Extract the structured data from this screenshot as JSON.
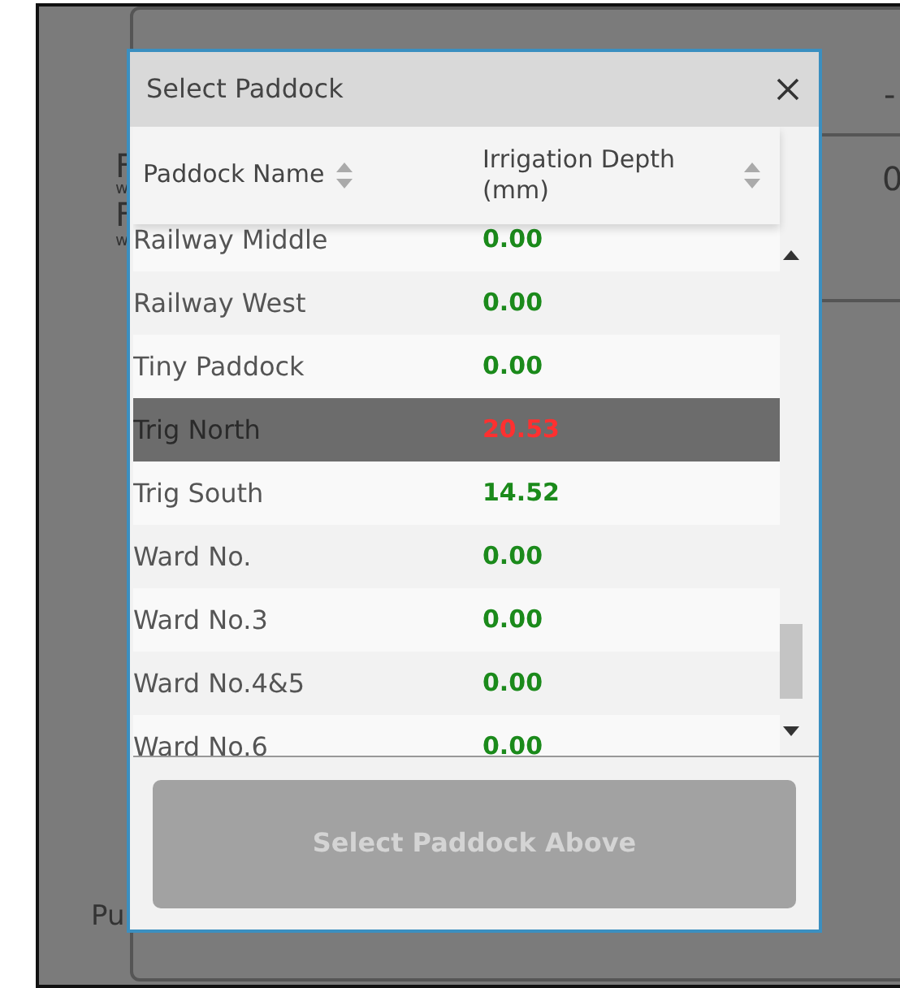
{
  "background_texts": [
    "F",
    "w",
    "F",
    "w",
    "-",
    "0",
    "Pu"
  ],
  "dialog": {
    "title": "Select Paddock",
    "columns": [
      {
        "label": "Paddock Name"
      },
      {
        "label": "Irrigation Depth (mm)"
      }
    ],
    "rows": [
      {
        "name": "Railway Middle",
        "depth": "0.00",
        "selected": false
      },
      {
        "name": "Railway West",
        "depth": "0.00",
        "selected": false
      },
      {
        "name": "Tiny Paddock",
        "depth": "0.00",
        "selected": false
      },
      {
        "name": "Trig North",
        "depth": "20.53",
        "selected": true
      },
      {
        "name": "Trig South",
        "depth": "14.52",
        "selected": false
      },
      {
        "name": "Ward No.",
        "depth": "0.00",
        "selected": false
      },
      {
        "name": "Ward No.3",
        "depth": "0.00",
        "selected": false
      },
      {
        "name": "Ward No.4&5",
        "depth": "0.00",
        "selected": false
      },
      {
        "name": "Ward No.6",
        "depth": "0.00",
        "selected": false
      }
    ],
    "button": {
      "label": "Select Paddock Above",
      "disabled": true
    }
  }
}
